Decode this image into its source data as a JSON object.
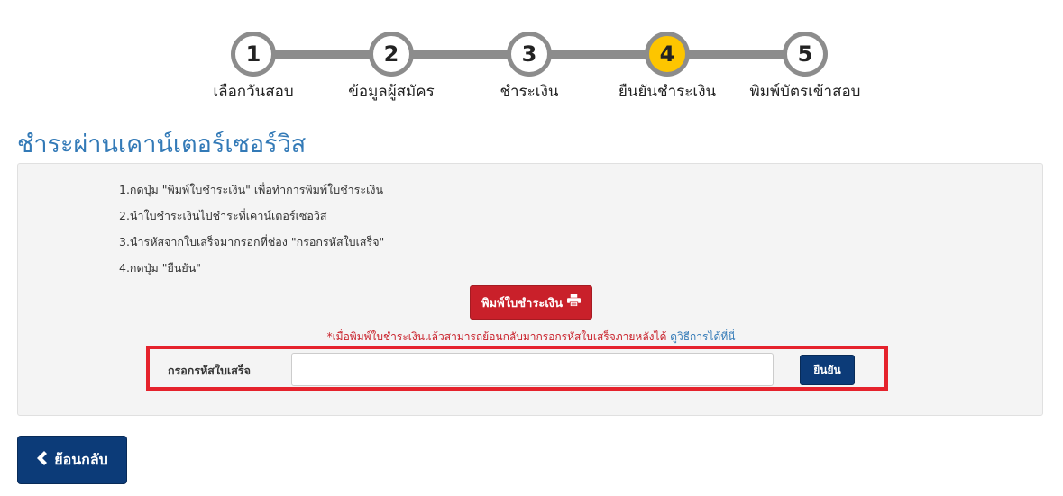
{
  "stepper": {
    "steps": [
      {
        "number": "1",
        "label": "เลือกวันสอบ"
      },
      {
        "number": "2",
        "label": "ข้อมูลผู้สมัคร"
      },
      {
        "number": "3",
        "label": "ชำระเงิน"
      },
      {
        "number": "4",
        "label": "ยืนยันชำระเงิน"
      },
      {
        "number": "5",
        "label": "พิมพ์บัตรเข้าสอบ"
      }
    ],
    "active_step": 4,
    "colors": {
      "active": "#fdc500",
      "inactive": "#8c8c8c"
    }
  },
  "page_title": "ชำระผ่านเคาน์เตอร์เซอร์วิส",
  "instructions": [
    "1.กดปุ่ม \"พิมพ์ใบชำระเงิน\" เพื่อทำการพิมพ์ใบชำระเงิน",
    "2.นำใบชำระเงินไปชำระที่เคาน์เตอร์เซอวิส",
    "3.นำรหัสจากใบเสร็จมากรอกที่ช่อง \"กรอกรหัสใบเสร็จ\"",
    "4.กดปุ่ม \"ยืนยัน\""
  ],
  "print_button": {
    "label": "พิมพ์ใบชำระเงิน",
    "icon": "printer-icon",
    "color": "#c9202a"
  },
  "note": {
    "text": "*เมื่อพิมพ์ใบชำระเงินแล้วสามารถย้อนกลับมากรอกรหัสใบเสร็จภายหลังได้ ",
    "link": "ดูวิธีการได้ที่นี่"
  },
  "receipt": {
    "label": "กรอกรหัสใบเสร็จ",
    "value": "",
    "placeholder": "",
    "confirm_label": "ยืนยัน",
    "highlight_color": "#e5222c"
  },
  "back_button": {
    "label": "ย้อนกลับ",
    "icon": "chevron-left-icon",
    "color": "#0c3b78"
  }
}
